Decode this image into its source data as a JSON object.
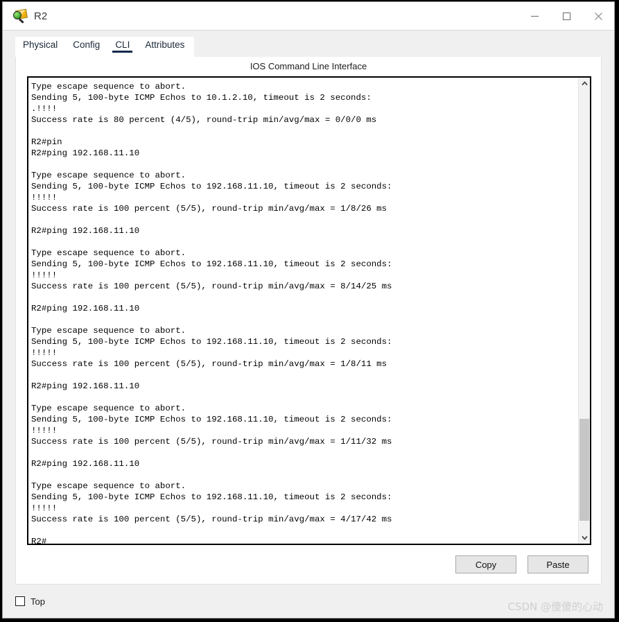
{
  "window": {
    "title": "R2",
    "icon": "packet-tracer-device-icon",
    "controls": {
      "minimize": "minimize-icon",
      "maximize": "maximize-icon",
      "close": "close-icon"
    }
  },
  "tabs": [
    {
      "label": "Physical",
      "active": false
    },
    {
      "label": "Config",
      "active": false
    },
    {
      "label": "CLI",
      "active": true
    },
    {
      "label": "Attributes",
      "active": false
    }
  ],
  "panel": {
    "heading": "IOS Command Line Interface",
    "terminal_text": "Type escape sequence to abort.\nSending 5, 100-byte ICMP Echos to 10.1.2.10, timeout is 2 seconds:\n.!!!!\nSuccess rate is 80 percent (4/5), round-trip min/avg/max = 0/0/0 ms\n\nR2#pin\nR2#ping 192.168.11.10\n\nType escape sequence to abort.\nSending 5, 100-byte ICMP Echos to 192.168.11.10, timeout is 2 seconds:\n!!!!!\nSuccess rate is 100 percent (5/5), round-trip min/avg/max = 1/8/26 ms\n\nR2#ping 192.168.11.10\n\nType escape sequence to abort.\nSending 5, 100-byte ICMP Echos to 192.168.11.10, timeout is 2 seconds:\n!!!!!\nSuccess rate is 100 percent (5/5), round-trip min/avg/max = 8/14/25 ms\n\nR2#ping 192.168.11.10\n\nType escape sequence to abort.\nSending 5, 100-byte ICMP Echos to 192.168.11.10, timeout is 2 seconds:\n!!!!!\nSuccess rate is 100 percent (5/5), round-trip min/avg/max = 1/8/11 ms\n\nR2#ping 192.168.11.10\n\nType escape sequence to abort.\nSending 5, 100-byte ICMP Echos to 192.168.11.10, timeout is 2 seconds:\n!!!!!\nSuccess rate is 100 percent (5/5), round-trip min/avg/max = 1/11/32 ms\n\nR2#ping 192.168.11.10\n\nType escape sequence to abort.\nSending 5, 100-byte ICMP Echos to 192.168.11.10, timeout is 2 seconds:\n!!!!!\nSuccess rate is 100 percent (5/5), round-trip min/avg/max = 4/17/42 ms\n\nR2#"
  },
  "scrollbar": {
    "up_arrow": "chevron-up-icon",
    "down_arrow": "chevron-down-icon"
  },
  "buttons": {
    "copy": "Copy",
    "paste": "Paste"
  },
  "footer": {
    "top_checkbox_label": "Top",
    "top_checked": false,
    "watermark": "CSDN @傻傻的心动"
  },
  "colors": {
    "accent": "#13294b",
    "terminal_text": "#000000",
    "window_chrome": "#f0f0f0",
    "button_face": "#e6e6e6"
  }
}
